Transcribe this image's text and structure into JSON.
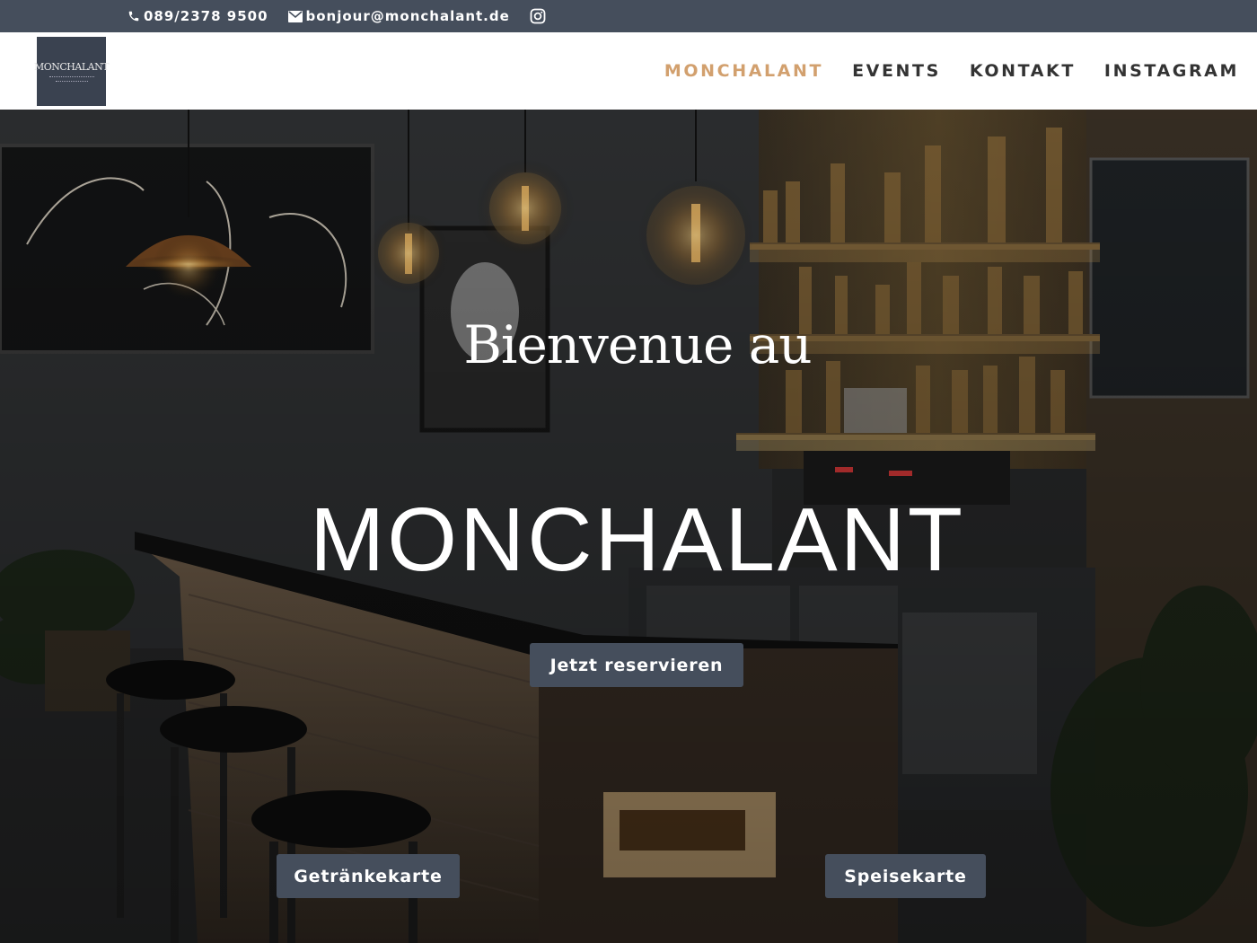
{
  "topbar": {
    "phone": "089/2378 9500",
    "email": "bonjour@monchalant.de",
    "icons": {
      "phone": "phone-icon",
      "email": "envelope-icon",
      "social": "instagram-icon"
    }
  },
  "header": {
    "logo_text": "MONCHALANT",
    "nav": [
      {
        "label": "MONCHALANT",
        "active": true
      },
      {
        "label": "EVENTS",
        "active": false
      },
      {
        "label": "KONTAKT",
        "active": false
      },
      {
        "label": "INSTAGRAM",
        "active": false
      }
    ]
  },
  "hero": {
    "subtitle": "Bienvenue au",
    "title": "MONCHALANT",
    "reserve_button": "Jetzt reservieren",
    "drinks_button": "Getränkekarte",
    "food_button": "Speisekarte",
    "background": "bar-interior-photo"
  },
  "colors": {
    "topbar_bg": "#454e5c",
    "accent": "#d2a06e",
    "button_bg": "#454e5c",
    "nav_text": "#333333"
  }
}
